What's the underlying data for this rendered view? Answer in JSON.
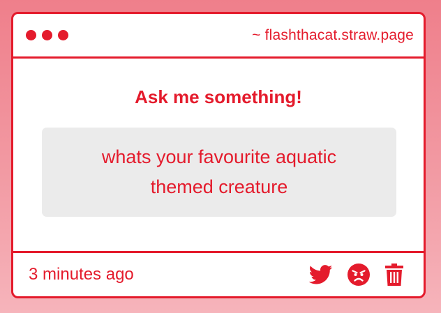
{
  "window": {
    "site_label": "~ flashthacat.straw.page"
  },
  "main": {
    "prompt": "Ask me something!",
    "question": "whats your favourite aquatic themed creature"
  },
  "footer": {
    "timestamp": "3 minutes ago",
    "actions": [
      {
        "icon": "twitter-icon"
      },
      {
        "icon": "angry-face-icon"
      },
      {
        "icon": "trash-icon"
      }
    ]
  },
  "colors": {
    "accent": "#e41b2c",
    "background_top": "#ef7f8b",
    "background_bottom": "#f6b4bb",
    "question_box": "#ebebeb",
    "card": "#ffffff"
  }
}
